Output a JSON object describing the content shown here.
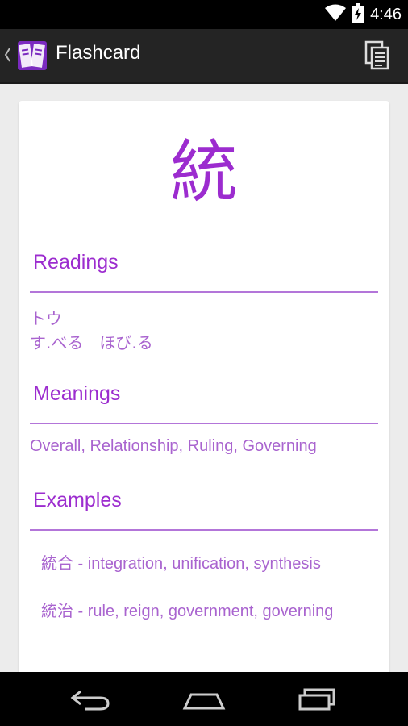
{
  "status_bar": {
    "time": "4:46",
    "icons": [
      "wifi-icon",
      "battery-charging-icon"
    ]
  },
  "action_bar": {
    "title": "Flashcard",
    "icons": [
      "up-chevron-icon",
      "app-logo-icon",
      "copy-icon"
    ]
  },
  "card": {
    "kanji": "統",
    "readings": {
      "title": "Readings",
      "on": "トウ",
      "kun": "す.べる　ほび.る"
    },
    "meanings": {
      "title": "Meanings",
      "text": "Overall, Relationship, Ruling, Governing"
    },
    "examples": {
      "title": "Examples",
      "items": [
        {
          "text": "統合  -  integration, unification, synthesis"
        },
        {
          "text": "統治  -  rule, reign, government, governing"
        }
      ]
    }
  },
  "nav_bar": {
    "icons": [
      "back-icon",
      "home-icon",
      "recents-icon"
    ]
  },
  "colors": {
    "accent": "#9c2ccf",
    "text": "#a964cf",
    "divider": "#b375d9",
    "action_bar": "#242424"
  }
}
